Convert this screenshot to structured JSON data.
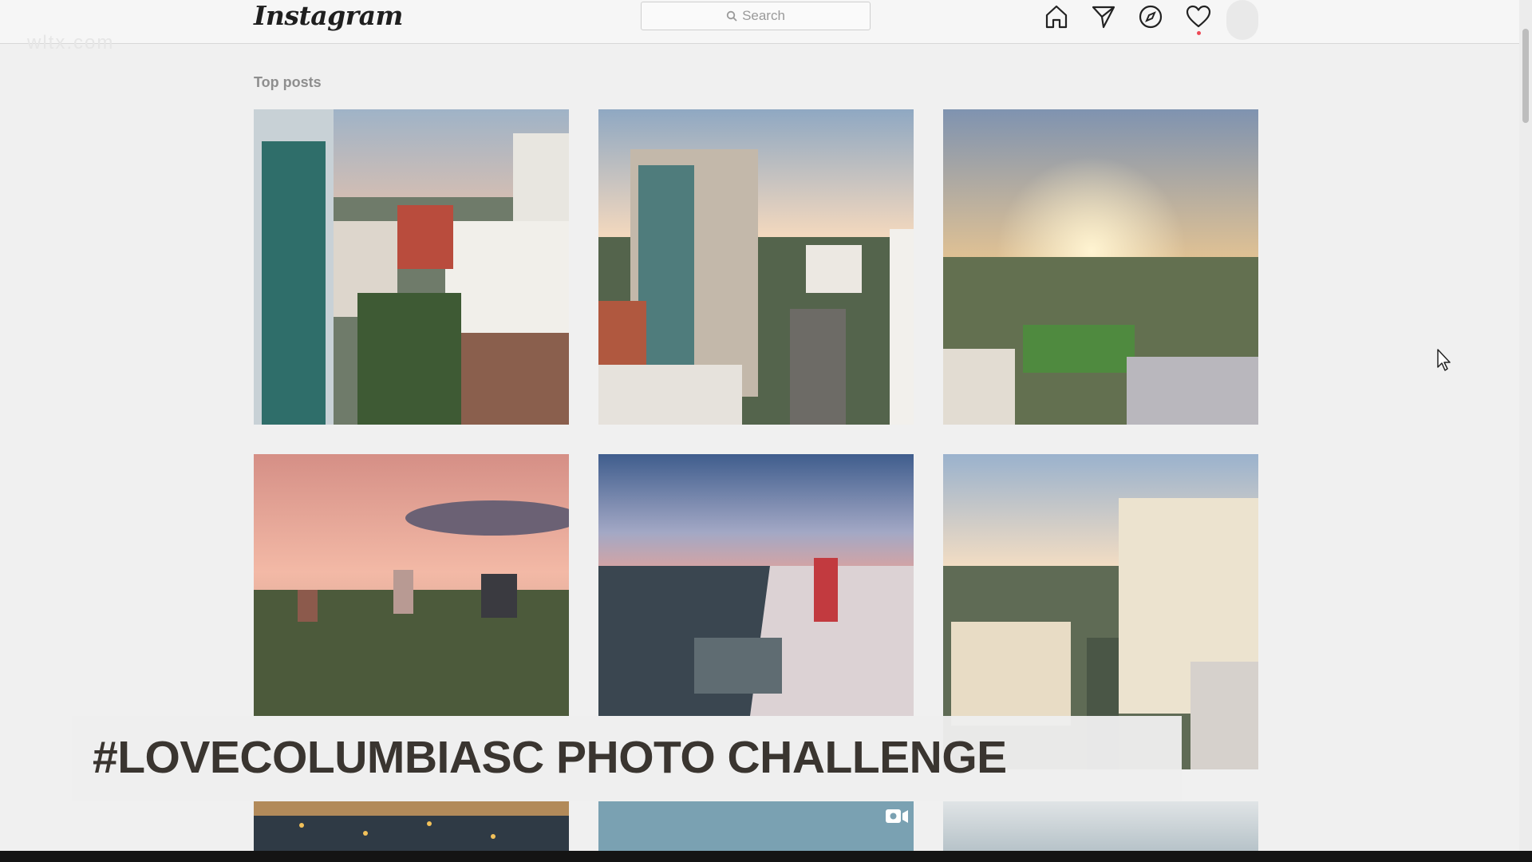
{
  "header": {
    "logo": "Instagram",
    "search_placeholder": "Search",
    "icons": [
      "home-icon",
      "direct-icon",
      "explore-icon",
      "activity-heart-icon",
      "profile-avatar"
    ]
  },
  "section": {
    "title": "Top posts"
  },
  "posts": [
    {
      "alt": "Downtown Columbia aerial view between high-rise buildings"
    },
    {
      "alt": "Office tower at sunset overlooking street"
    },
    {
      "alt": "Sunset over city with sports field"
    },
    {
      "alt": "Pink sunset over city skyline and trees"
    },
    {
      "alt": "Stadium aerial view at dusk"
    },
    {
      "alt": "Sunlit downtown buildings aerial view"
    },
    {
      "alt": "City lights at night"
    },
    {
      "alt": "Blue sky video post"
    },
    {
      "alt": "Cloudy sky post"
    }
  ],
  "lower_third": {
    "text": "#LOVECOLUMBIASC PHOTO CHALLENGE"
  },
  "colors": {
    "accent_notification": "#ed4956",
    "lower_third_text": "#3a3530"
  }
}
